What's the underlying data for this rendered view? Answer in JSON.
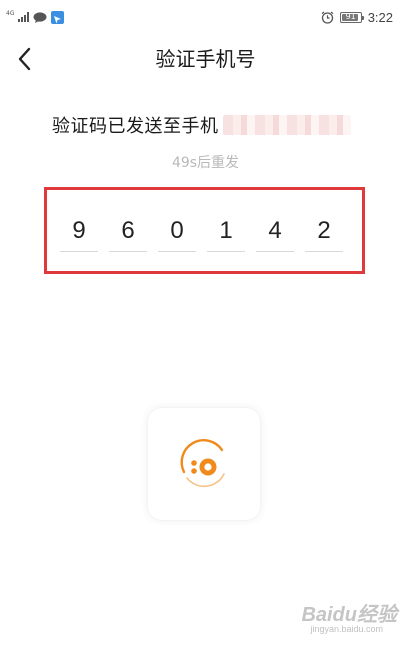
{
  "status_bar": {
    "network": "4G",
    "battery_level": "91",
    "battery_fraction": 0.91,
    "time": "3:22",
    "icons": [
      "signal-icon",
      "chat-icon",
      "app-notification-icon",
      "alarm-icon",
      "battery-icon"
    ]
  },
  "nav": {
    "back_icon": "chevron-left-icon",
    "title": "验证手机号"
  },
  "message": {
    "text": "验证码已发送至手机"
  },
  "resend": {
    "text": "49s后重发"
  },
  "code": {
    "digits": [
      "9",
      "6",
      "0",
      "1",
      "4",
      "2"
    ],
    "highlight_color": "#e0393c"
  },
  "logo": {
    "icon": "app-logo-icon",
    "accent": "#f08a1c"
  },
  "watermark": {
    "brand": "Baidu经验",
    "url": "jingyan.baidu.com"
  }
}
